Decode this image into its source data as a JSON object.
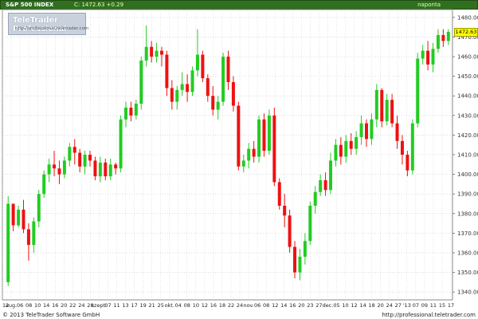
{
  "header": {
    "instrument": "S&P 500 INDEX",
    "last_change": "C: 1472.63 +0.29",
    "period": "naponta"
  },
  "logo": {
    "brand": "TeleTrader Professional",
    "url": "http://professional.teletrader.com"
  },
  "footer": {
    "copyright": "© 2013 TeleTrader Software GmbH",
    "site": "http://professional.teletrader.com"
  },
  "last_price_tag": "1472.63",
  "colors": {
    "up": "#22cc22",
    "down": "#ee1111",
    "header_bg": "#2f6f1f",
    "grid": "#c8c8c8",
    "last_price_bg": "#ffff00"
  },
  "chart_data": {
    "type": "candlestick",
    "title": "S&P 500 INDEX",
    "ylim": [
      1336,
      1484
    ],
    "yticks": [
      1340,
      1350,
      1360,
      1370,
      1380,
      1390,
      1400,
      1410,
      1420,
      1430,
      1440,
      1450,
      1460,
      1470,
      1480
    ],
    "xtick_labels": [
      "12",
      "aug.",
      "06",
      "08",
      "10",
      "14",
      "16",
      "20",
      "22",
      "24",
      "28",
      "szept.",
      "07",
      "11",
      "13",
      "17",
      "19",
      "21",
      "25",
      "okt.",
      "04",
      "08",
      "10",
      "12",
      "16",
      "18",
      "22",
      "24",
      "nov.",
      "06",
      "08",
      "12",
      "14",
      "16",
      "20",
      "23",
      "27",
      "dec.",
      "05",
      "10",
      "12",
      "14",
      "18",
      "20",
      "24",
      "27",
      "'13",
      "07",
      "09",
      "11",
      "15",
      "17"
    ],
    "grid": true,
    "candles": [
      [
        1345,
        1389,
        1343,
        1385
      ],
      [
        1385,
        1385,
        1371,
        1374
      ],
      [
        1374,
        1384,
        1373,
        1382
      ],
      [
        1382,
        1387,
        1370,
        1372
      ],
      [
        1372,
        1375,
        1356,
        1364
      ],
      [
        1364,
        1378,
        1360,
        1376
      ],
      [
        1376,
        1392,
        1373,
        1390
      ],
      [
        1390,
        1402,
        1388,
        1400
      ],
      [
        1400,
        1408,
        1396,
        1405
      ],
      [
        1405,
        1412,
        1399,
        1403
      ],
      [
        1403,
        1407,
        1395,
        1400
      ],
      [
        1400,
        1409,
        1398,
        1407
      ],
      [
        1407,
        1416,
        1404,
        1414
      ],
      [
        1414,
        1418,
        1405,
        1411
      ],
      [
        1411,
        1413,
        1401,
        1404
      ],
      [
        1404,
        1412,
        1400,
        1410
      ],
      [
        1410,
        1412,
        1404,
        1407
      ],
      [
        1407,
        1409,
        1397,
        1399
      ],
      [
        1399,
        1409,
        1396,
        1406
      ],
      [
        1406,
        1408,
        1397,
        1399
      ],
      [
        1399,
        1408,
        1397,
        1405
      ],
      [
        1405,
        1406,
        1400,
        1403
      ],
      [
        1403,
        1430,
        1401,
        1428
      ],
      [
        1428,
        1437,
        1424,
        1434
      ],
      [
        1434,
        1437,
        1427,
        1430
      ],
      [
        1430,
        1438,
        1428,
        1436
      ],
      [
        1436,
        1460,
        1433,
        1458
      ],
      [
        1458,
        1476,
        1455,
        1465
      ],
      [
        1465,
        1468,
        1457,
        1460
      ],
      [
        1460,
        1467,
        1457,
        1463
      ],
      [
        1463,
        1465,
        1455,
        1461
      ],
      [
        1461,
        1463,
        1440,
        1444
      ],
      [
        1444,
        1448,
        1433,
        1437
      ],
      [
        1437,
        1445,
        1433,
        1443
      ],
      [
        1443,
        1452,
        1440,
        1446
      ],
      [
        1446,
        1451,
        1437,
        1442
      ],
      [
        1442,
        1455,
        1440,
        1453
      ],
      [
        1453,
        1474,
        1450,
        1461
      ],
      [
        1461,
        1463,
        1447,
        1449
      ],
      [
        1449,
        1451,
        1437,
        1440
      ],
      [
        1440,
        1445,
        1430,
        1433
      ],
      [
        1433,
        1440,
        1428,
        1437
      ],
      [
        1437,
        1462,
        1435,
        1460
      ],
      [
        1460,
        1463,
        1443,
        1447
      ],
      [
        1447,
        1450,
        1432,
        1435
      ],
      [
        1435,
        1437,
        1402,
        1404
      ],
      [
        1404,
        1410,
        1401,
        1407
      ],
      [
        1407,
        1416,
        1403,
        1413
      ],
      [
        1413,
        1417,
        1406,
        1409
      ],
      [
        1409,
        1430,
        1406,
        1428
      ],
      [
        1428,
        1431,
        1409,
        1412
      ],
      [
        1412,
        1433,
        1410,
        1430
      ],
      [
        1430,
        1434,
        1394,
        1396
      ],
      [
        1396,
        1398,
        1382,
        1384
      ],
      [
        1384,
        1390,
        1373,
        1379
      ],
      [
        1379,
        1382,
        1360,
        1363
      ],
      [
        1363,
        1366,
        1347,
        1350
      ],
      [
        1350,
        1362,
        1346,
        1358
      ],
      [
        1358,
        1370,
        1354,
        1366
      ],
      [
        1366,
        1386,
        1364,
        1384
      ],
      [
        1384,
        1394,
        1380,
        1391
      ],
      [
        1391,
        1400,
        1389,
        1397
      ],
      [
        1397,
        1401,
        1389,
        1392
      ],
      [
        1392,
        1411,
        1390,
        1407
      ],
      [
        1407,
        1418,
        1404,
        1415
      ],
      [
        1415,
        1419,
        1405,
        1409
      ],
      [
        1409,
        1420,
        1406,
        1417
      ],
      [
        1417,
        1421,
        1410,
        1413
      ],
      [
        1413,
        1422,
        1410,
        1419
      ],
      [
        1419,
        1430,
        1415,
        1426
      ],
      [
        1426,
        1428,
        1414,
        1418
      ],
      [
        1418,
        1431,
        1415,
        1428
      ],
      [
        1428,
        1446,
        1424,
        1443
      ],
      [
        1443,
        1444,
        1424,
        1427
      ],
      [
        1427,
        1441,
        1425,
        1438
      ],
      [
        1438,
        1441,
        1424,
        1426
      ],
      [
        1426,
        1430,
        1413,
        1417
      ],
      [
        1417,
        1420,
        1405,
        1410
      ],
      [
        1410,
        1412,
        1399,
        1402
      ],
      [
        1402,
        1428,
        1400,
        1426
      ],
      [
        1426,
        1462,
        1424,
        1459
      ],
      [
        1459,
        1466,
        1456,
        1463
      ],
      [
        1463,
        1468,
        1453,
        1456
      ],
      [
        1456,
        1467,
        1452,
        1464
      ],
      [
        1464,
        1474,
        1462,
        1471
      ],
      [
        1471,
        1474,
        1465,
        1468
      ],
      [
        1468,
        1474,
        1466,
        1472.63
      ]
    ]
  }
}
